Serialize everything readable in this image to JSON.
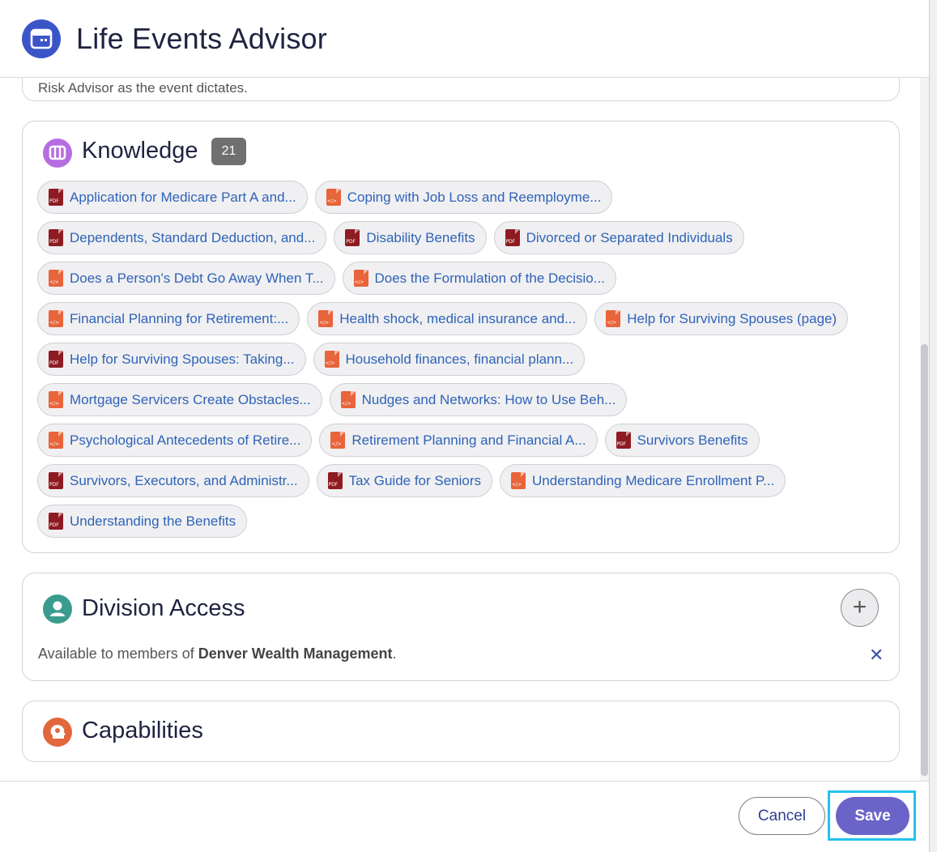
{
  "header": {
    "title": "Life Events Advisor",
    "icon": "calendar-window-icon"
  },
  "intro": {
    "text": "Risk Advisor as the event dictates."
  },
  "knowledge": {
    "title": "Knowledge",
    "count": "21",
    "icon": "book-icon",
    "rows": [
      [
        {
          "label": "Application for Medicare Part A and...",
          "type": "pdf"
        },
        {
          "label": "Coping with Job Loss and Reemployme...",
          "type": "html"
        }
      ],
      [
        {
          "label": "Dependents, Standard Deduction, and...",
          "type": "pdf"
        },
        {
          "label": "Disability Benefits",
          "type": "pdf"
        },
        {
          "label": "Divorced or Separated Individuals",
          "type": "pdf"
        }
      ],
      [
        {
          "label": "Does a Person's Debt Go Away When T...",
          "type": "html"
        },
        {
          "label": "Does the Formulation of the Decisio...",
          "type": "html"
        }
      ],
      [
        {
          "label": "Financial Planning for Retirement:...",
          "type": "html"
        },
        {
          "label": "Health shock, medical insurance and...",
          "type": "html"
        },
        {
          "label": "Help for Surviving Spouses (page)",
          "type": "html"
        }
      ],
      [
        {
          "label": "Help for Surviving Spouses: Taking...",
          "type": "pdf"
        },
        {
          "label": "Household finances, financial plann...",
          "type": "html"
        }
      ],
      [
        {
          "label": "Mortgage Servicers Create Obstacles...",
          "type": "html"
        },
        {
          "label": "Nudges and Networks: How to Use Beh...",
          "type": "html"
        }
      ],
      [
        {
          "label": "Psychological Antecedents of Retire...",
          "type": "html"
        },
        {
          "label": "Retirement Planning and Financial A...",
          "type": "html"
        },
        {
          "label": "Survivors Benefits",
          "type": "pdf"
        }
      ],
      [
        {
          "label": "Survivors, Executors, and Administr...",
          "type": "pdf"
        },
        {
          "label": "Tax Guide for Seniors",
          "type": "pdf"
        },
        {
          "label": "Understanding Medicare Enrollment P...",
          "type": "html"
        }
      ],
      [
        {
          "label": "Understanding the Benefits",
          "type": "pdf"
        }
      ]
    ]
  },
  "division": {
    "title": "Division Access",
    "icon": "person-icon",
    "add_symbol": "+",
    "available_prefix": "Available to members of ",
    "org": "Denver Wealth Management",
    "available_suffix": ".",
    "remove_symbol": "✕"
  },
  "capabilities": {
    "title": "Capabilities",
    "icon": "gear-head-icon"
  },
  "footer": {
    "cancel_label": "Cancel",
    "save_label": "Save"
  },
  "colors": {
    "accent": "#6a64c9",
    "focus": "#23c3ea",
    "link": "#2f63b8",
    "pdf": "#8e1b22",
    "html": "#e8643a"
  }
}
